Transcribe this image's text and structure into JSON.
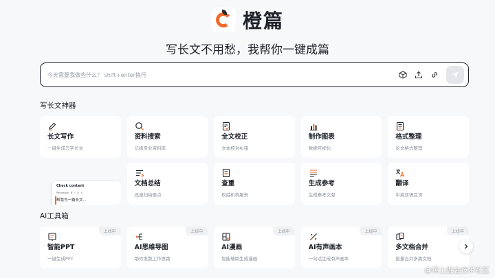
{
  "brand": {
    "name": "橙篇"
  },
  "tagline": "写长文不用愁，我帮你一键成篇",
  "search": {
    "placeholder": "今天需要我做些什么？ shift+enter换行"
  },
  "sections": {
    "tools": "写长文神器",
    "ai": "AI工具箱"
  },
  "tools_row1": [
    {
      "title": "长文写作",
      "desc": "一键生成万字长文",
      "icon": "pen-icon"
    },
    {
      "title": "资料搜索",
      "desc": "亿级专业资料库",
      "icon": "search-icon"
    },
    {
      "title": "全文校正",
      "desc": "文本校对纠错",
      "icon": "doc-check-icon"
    },
    {
      "title": "制作图表",
      "desc": "数据可视化",
      "icon": "chart-icon"
    },
    {
      "title": "格式整理",
      "desc": "论文格式整理",
      "icon": "format-doc-icon"
    }
  ],
  "tools_row2": [
    {
      "title": "文档总结",
      "desc": "迅速归纳要点",
      "icon": "summary-icon"
    },
    {
      "title": "查重",
      "desc": "权威机构服务",
      "icon": "duplicate-check-icon"
    },
    {
      "title": "生成参考",
      "desc": "生成参考文献",
      "icon": "reference-icon"
    },
    {
      "title": "翻译",
      "desc": "中英双语互译",
      "icon": "translate-icon"
    }
  ],
  "preview": {
    "heading": "Check content",
    "toolbar": [
      "Paragraph",
      "B",
      "I",
      "U",
      "S"
    ],
    "text": "帮我写一篇长文..."
  },
  "ai_tools": [
    {
      "title": "智能PPT",
      "desc": "一键生成PPT",
      "badge": "上线中",
      "icon": "ppt-icon"
    },
    {
      "title": "AI思维导图",
      "desc": "助你发散工作思路",
      "badge": "上线中",
      "icon": "mindmap-icon"
    },
    {
      "title": "AI漫画",
      "desc": "智能辅助生成漫画",
      "badge": "上线中",
      "icon": "comic-icon"
    },
    {
      "title": "AI有声画本",
      "desc": "一句话生成有声画本",
      "badge": "上线中",
      "icon": "audiobook-icon"
    },
    {
      "title": "多文档合并",
      "desc": "批量合并多篇文档",
      "badge": "上线中",
      "icon": "merge-docs-icon"
    }
  ],
  "watermark": "@稀土掘金技术社区",
  "colors": {
    "accent": "#f06a2c",
    "text": "#1f2329",
    "muted": "#8a8f98",
    "background": "#f7f8fa"
  }
}
